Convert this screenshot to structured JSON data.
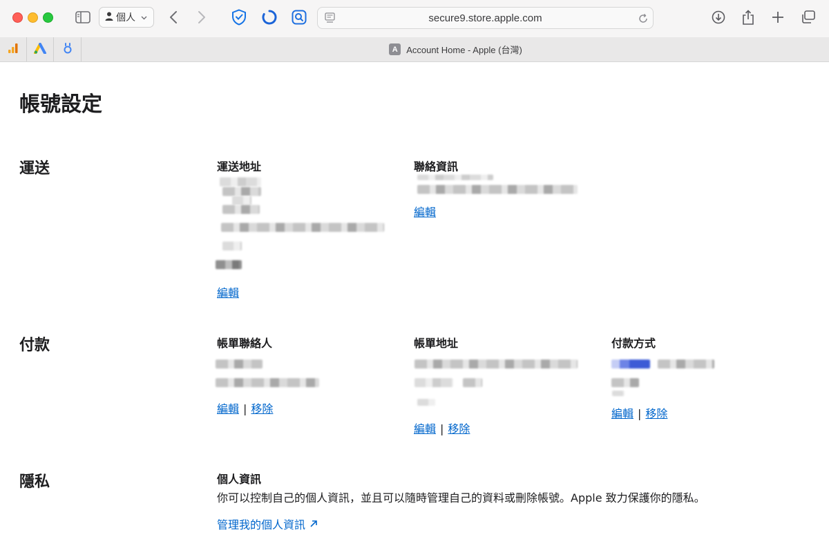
{
  "browser": {
    "url": "secure9.store.apple.com",
    "profile_label": "個人",
    "tab_title": "Account Home - Apple (台灣)",
    "tab_favicon_letter": "A"
  },
  "page": {
    "title": "帳號設定",
    "sections": {
      "shipping": {
        "label": "運送",
        "address_title": "運送地址",
        "address_edit": "編輯",
        "contact_title": "聯絡資訊",
        "contact_edit": "編輯"
      },
      "payment": {
        "label": "付款",
        "billing_contact_title": "帳單聯絡人",
        "billing_contact_edit": "編輯",
        "billing_contact_remove": "移除",
        "billing_address_title": "帳單地址",
        "billing_address_edit": "編輯",
        "billing_address_remove": "移除",
        "method_title": "付款方式",
        "method_edit": "編輯",
        "method_remove": "移除",
        "separator": "|"
      },
      "privacy": {
        "label": "隱私",
        "title": "個人資訊",
        "description": "你可以控制自己的個人資訊，並且可以隨時管理自己的資料或刪除帳號。Apple 致力保護你的隱私。",
        "manage_link": "管理我的個人資訊"
      }
    }
  },
  "colors": {
    "link": "#0066cc",
    "text": "#1d1d1f",
    "toolbar_bg": "#f6f5f5",
    "tabbar_bg": "#e9e8e8"
  },
  "icons": [
    "sidebar-icon",
    "person-icon",
    "chevron-down-icon",
    "back-icon",
    "forward-icon",
    "privacy-shield-icon",
    "loading-icon",
    "search-extension-icon",
    "page-icon",
    "reload-icon",
    "download-icon",
    "share-icon",
    "new-tab-icon",
    "tab-overview-icon",
    "arrow-up-right-icon"
  ]
}
